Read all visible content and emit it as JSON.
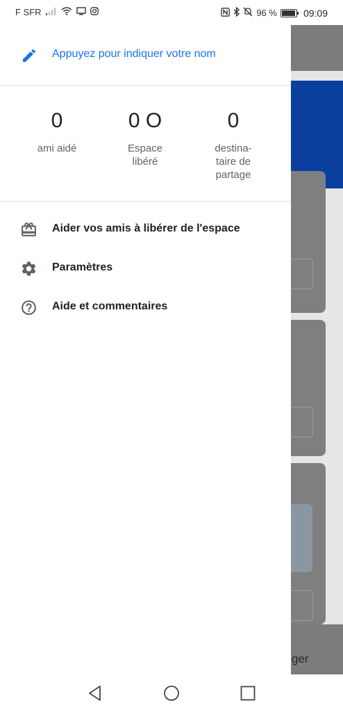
{
  "status_bar": {
    "carrier": "F SFR",
    "battery_percent": "96 %",
    "battery_level": 0.96,
    "time": "09:09",
    "icons": [
      "signal-icon",
      "wifi-icon",
      "cast-icon",
      "instagram-icon",
      "nfc-icon",
      "bluetooth-icon",
      "mute-icon",
      "battery-icon"
    ]
  },
  "drawer": {
    "name_prompt": "Appuyez pour indiquer votre nom",
    "stats": [
      {
        "value": "0",
        "label": "ami aidé"
      },
      {
        "value": "0 O",
        "label": "Espace\nlibéré"
      },
      {
        "value": "0",
        "label": "destina-\ntaire de\npartage"
      }
    ],
    "menu": [
      {
        "label": "Aider vos amis à libérer de l'espace",
        "icon": "gift-card-icon"
      },
      {
        "label": "Paramètres",
        "icon": "gear-icon"
      },
      {
        "label": "Aide et commentaires",
        "icon": "help-icon"
      }
    ]
  },
  "background_app": {
    "bottom_tab_fragment": "ger"
  },
  "nav_bar": {
    "icons": [
      "back-icon",
      "home-icon",
      "recents-icon"
    ]
  },
  "colors": {
    "accent": "#1a73e8",
    "text_primary": "#202124",
    "text_secondary": "#5f6368",
    "divider": "#dadce0",
    "scrim_blue": "#0a3fa0"
  }
}
